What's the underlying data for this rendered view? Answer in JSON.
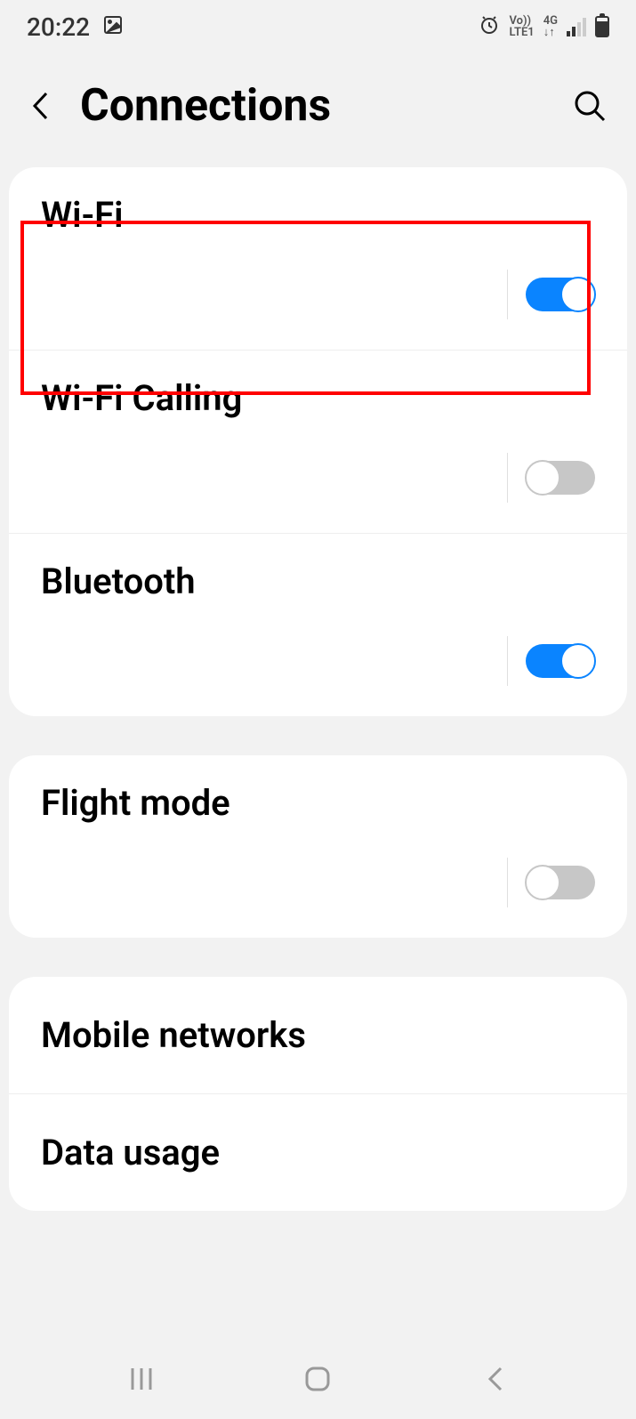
{
  "status": {
    "time": "20:22",
    "volte_top": "Vo))",
    "volte_bottom": "LTE1",
    "network_top": "4G",
    "network_bottom": "↓↑"
  },
  "header": {
    "title": "Connections"
  },
  "groups": [
    {
      "items": [
        {
          "label": "Wi-Fi",
          "toggle": true,
          "on": true,
          "highlight": true
        },
        {
          "label": "Wi-Fi Calling",
          "toggle": true,
          "on": false
        },
        {
          "label": "Bluetooth",
          "toggle": true,
          "on": true
        }
      ]
    },
    {
      "items": [
        {
          "label": "Flight mode",
          "toggle": true,
          "on": false
        }
      ]
    },
    {
      "items": [
        {
          "label": "Mobile networks",
          "toggle": false
        },
        {
          "label": "Data usage",
          "toggle": false
        }
      ]
    }
  ]
}
